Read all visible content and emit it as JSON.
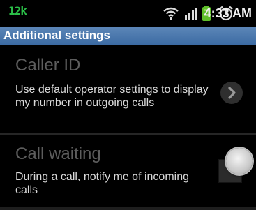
{
  "status_bar": {
    "left_indicator": "12k",
    "time": "4:33 AM",
    "icons": [
      "wifi-icon",
      "signal-icon",
      "battery-icon",
      "alarm-icon"
    ],
    "indicator_color": "#2bbf48",
    "battery_color": "#5fbf2a"
  },
  "header": {
    "title": "Additional settings",
    "color": "#4a78ad"
  },
  "settings": {
    "caller_id": {
      "title": "Caller ID",
      "summary": "Use default operator settings to display my number in outgoing calls",
      "widget_icon": "chevron-right-icon"
    },
    "call_waiting": {
      "title": "Call waiting",
      "summary": "During a call, notify me of incoming calls",
      "widget_icon": "checkbox-toggle-icon",
      "checked": false
    }
  }
}
